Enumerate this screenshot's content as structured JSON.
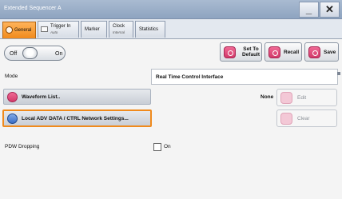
{
  "window": {
    "title": "Extended Sequencer A",
    "minimize_label": "_",
    "close_label": "✕"
  },
  "tabs": [
    {
      "label": "General",
      "sub": ""
    },
    {
      "label": "Trigger In",
      "sub": "Auto"
    },
    {
      "label": "Marker",
      "sub": ""
    },
    {
      "label": "Clock",
      "sub": "Internal"
    },
    {
      "label": "Statistics",
      "sub": ""
    }
  ],
  "state_toggle": {
    "off_label": "Off",
    "on_label": "On",
    "state": "off"
  },
  "toolbar": {
    "set_to_default_label": "Set To Default",
    "recall_label": "Recall",
    "save_label": "Save"
  },
  "mode": {
    "label": "Mode",
    "value": "Real Time Control Interface"
  },
  "waveform_list": {
    "label": "Waveform List..",
    "value": "None"
  },
  "edit_button": {
    "label": "Edit"
  },
  "network_settings": {
    "label": "Local ADV DATA / CTRL Network Settings..."
  },
  "clear_button": {
    "label": "Clear"
  },
  "pdw_dropping": {
    "label": "PDW Dropping",
    "checkbox_label": "On",
    "checked": false
  },
  "colors": {
    "accent": "#f08a1c",
    "titlebar": "#9bafc9",
    "button_icon": "#e04c7e"
  }
}
